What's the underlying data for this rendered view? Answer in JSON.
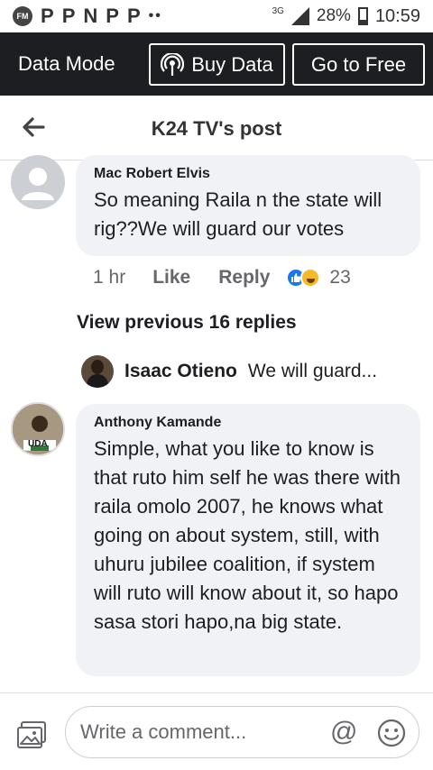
{
  "status_bar": {
    "fm_label": "FM",
    "app_icons": [
      "P",
      "P",
      "N",
      "P",
      "P"
    ],
    "more_dots": "••",
    "network": "3G",
    "battery": "28%",
    "time": "10:59"
  },
  "data_bar": {
    "data_mode_label": "Data Mode",
    "buy_data_label": "Buy Data",
    "go_free_label": "Go to Free"
  },
  "header": {
    "title": "K24 TV's post"
  },
  "comments": [
    {
      "author": "Mac Robert Elvis",
      "text": "So meaning Raila n the state will rig??We will guard our votes",
      "time": "1 hr",
      "like_label": "Like",
      "reply_label": "Reply",
      "reactions_count": "23"
    },
    {
      "author": "Anthony Kamande",
      "text": "Simple, what you like to know is that ruto him self he was there with raila omolo 2007, he knows what going on about system, still, with uhuru jubilee coalition, if system will ruto will know about it, so hapo sasa stori hapo,na big state.",
      "avatar_badge": "UDA"
    }
  ],
  "view_previous": "View previous 16 replies",
  "reply_preview": {
    "name": "Isaac Otieno",
    "text": "We will guard..."
  },
  "composer": {
    "placeholder": "Write a comment...",
    "at_symbol": "@"
  }
}
